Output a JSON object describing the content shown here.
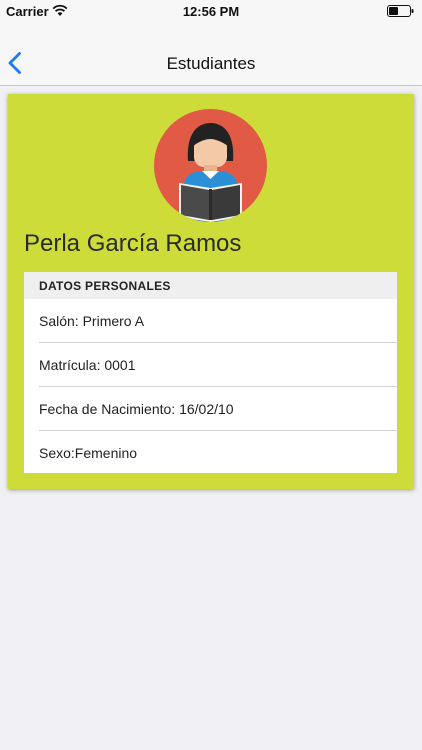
{
  "status_bar": {
    "carrier": "Carrier",
    "time": "12:56 PM",
    "wifi_icon": "wifi-icon",
    "battery_icon": "battery-icon"
  },
  "nav": {
    "title": "Estudiantes",
    "back_icon": "chevron-left-icon",
    "accent_color": "#1a7cf0"
  },
  "profile": {
    "card_color": "#cddc39",
    "avatar_icon": "student-reading-avatar-icon",
    "avatar_bg_color": "#e05a45",
    "name": "Perla García Ramos"
  },
  "personal_data": {
    "header": "DATOS PERSONALES",
    "rows": [
      "Salón: Primero A",
      "Matrícula: 0001",
      "Fecha de Nacimiento: 16/02/10",
      "Sexo:Femenino"
    ]
  }
}
